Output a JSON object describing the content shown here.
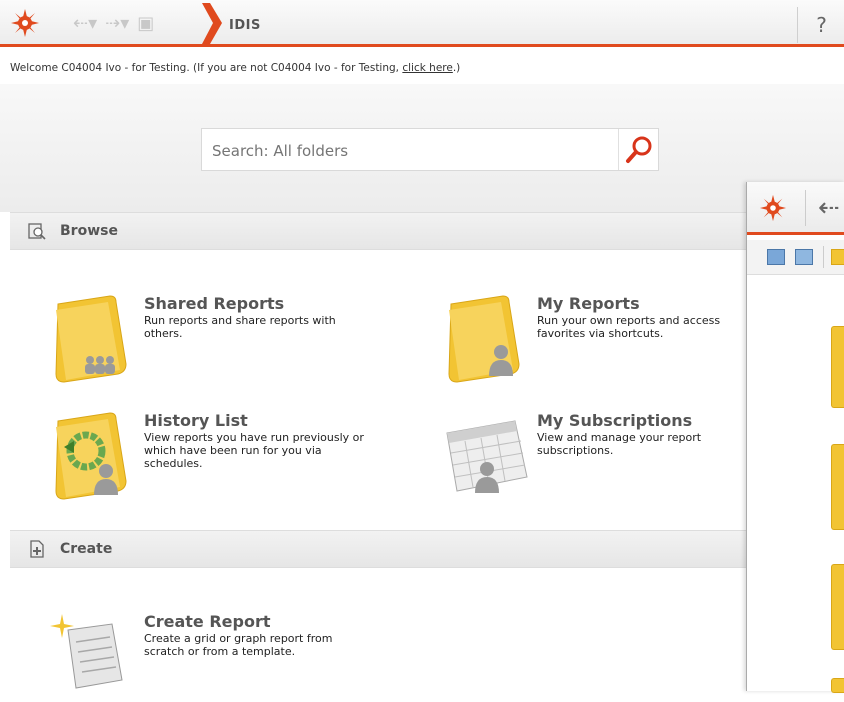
{
  "toolbar": {
    "app_title": "IDIS",
    "help_label": "?",
    "icons": [
      "sunburst-logo-icon",
      "back-arrow-icon",
      "forward-arrow-icon",
      "home-icon",
      "help-icon"
    ]
  },
  "welcome": {
    "prefix": "Welcome C04004 Ivo - for Testing. (If you are not C04004 Ivo - for Testing, ",
    "link": "click here",
    "suffix": ".)"
  },
  "search": {
    "placeholder": "Search: All folders"
  },
  "browse": {
    "label": "Browse",
    "items": [
      {
        "title": "Shared Reports",
        "desc": "Run reports and share reports with others."
      },
      {
        "title": "My Reports",
        "desc": "Run your own reports and access favorites via shortcuts."
      },
      {
        "title": "History List",
        "desc": "View reports you have run previously or which have been run for you via schedules."
      },
      {
        "title": "My Subscriptions",
        "desc": "View and manage your report subscriptions."
      }
    ]
  },
  "create": {
    "label": "Create",
    "items": [
      {
        "title": "Create Report",
        "desc": "Create a grid or graph report from scratch or from a template."
      }
    ]
  },
  "colors": {
    "accent": "#e04a1e",
    "folder": "#f2c433"
  }
}
